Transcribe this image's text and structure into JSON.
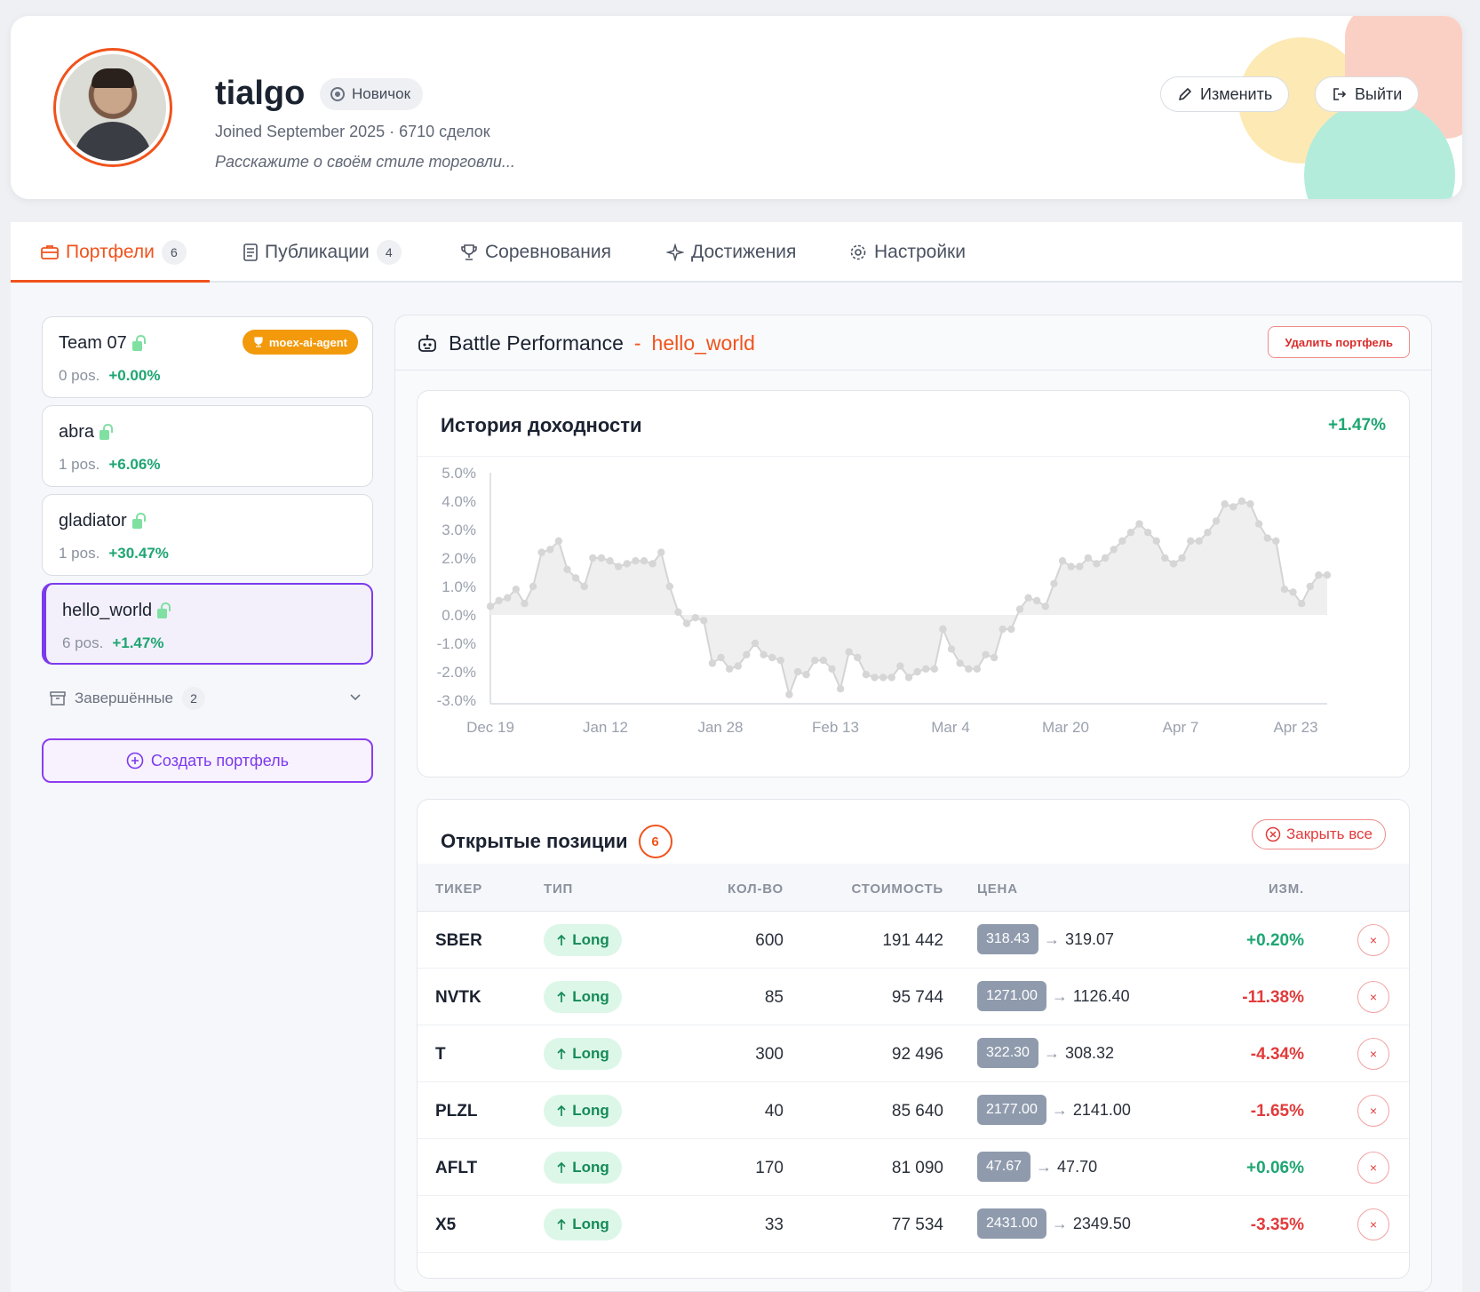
{
  "profile": {
    "username": "tialgo",
    "rank": "Новичок",
    "joined": "Joined September 2025 · 6710 сделок",
    "bio": "Расскажите о своём стиле торговли...",
    "edit_label": "Изменить",
    "logout_label": "Выйти"
  },
  "tabs": [
    {
      "label": "Портфели",
      "count": "6"
    },
    {
      "label": "Публикации",
      "count": "4"
    },
    {
      "label": "Соревнования"
    },
    {
      "label": "Достижения"
    },
    {
      "label": "Настройки"
    }
  ],
  "sidebar": {
    "portfolios": [
      {
        "name": "Team 07",
        "positions": "0 pos.",
        "return": "+0.00%",
        "badge": "moex-ai-agent"
      },
      {
        "name": "abra",
        "positions": "1 pos.",
        "return": "+6.06%"
      },
      {
        "name": "gladiator",
        "positions": "1 pos.",
        "return": "+30.47%"
      },
      {
        "name": "hello_world",
        "positions": "6 pos.",
        "return": "+1.47%"
      }
    ],
    "completed_label": "Завершённые",
    "completed_count": "2",
    "create_label": "Создать портфель"
  },
  "panel": {
    "title": "Battle Performance",
    "separator": "-",
    "portfolio_name": "hello_world",
    "delete_label": "Удалить портфель"
  },
  "chart": {
    "title": "История доходности",
    "total_return": "+1.47%"
  },
  "chart_data": {
    "type": "area",
    "title": "История доходности",
    "xlabel": "",
    "ylabel": "",
    "x_ticks": [
      "Dec 19",
      "Jan 12",
      "Jan 28",
      "Feb 13",
      "Mar 4",
      "Mar 20",
      "Apr 7",
      "Apr 23"
    ],
    "y_ticks": [
      "5.0%",
      "4.0%",
      "3.0%",
      "2.0%",
      "1.0%",
      "0.0%",
      "-1.0%",
      "-2.0%",
      "-3.0%"
    ],
    "ylim": [
      -3.0,
      5.0
    ],
    "grid": false,
    "series": [
      {
        "values": [
          0.3,
          0.5,
          0.6,
          0.9,
          0.4,
          1.0,
          2.2,
          2.3,
          2.6,
          1.6,
          1.3,
          1.0,
          2.0,
          2.0,
          1.9,
          1.7,
          1.8,
          1.9,
          1.9,
          1.8,
          2.2,
          1.0,
          0.1,
          -0.3,
          -0.1,
          -0.2,
          -1.7,
          -1.5,
          -1.9,
          -1.8,
          -1.4,
          -1.0,
          -1.4,
          -1.5,
          -1.6,
          -2.8,
          -2.0,
          -2.1,
          -1.6,
          -1.6,
          -1.9,
          -2.6,
          -1.3,
          -1.5,
          -2.1,
          -2.2,
          -2.2,
          -2.2,
          -1.8,
          -2.2,
          -2.0,
          -1.9,
          -1.9,
          -0.5,
          -1.2,
          -1.7,
          -1.9,
          -1.9,
          -1.4,
          -1.5,
          -0.5,
          -0.5,
          0.2,
          0.6,
          0.5,
          0.3,
          1.1,
          1.9,
          1.7,
          1.7,
          2.0,
          1.8,
          2.0,
          2.3,
          2.6,
          2.9,
          3.2,
          2.9,
          2.6,
          2.0,
          1.8,
          2.0,
          2.6,
          2.6,
          2.9,
          3.3,
          3.9,
          3.8,
          4.0,
          3.9,
          3.2,
          2.7,
          2.6,
          0.9,
          0.8,
          0.4,
          1.0,
          1.4,
          1.4
        ]
      }
    ]
  },
  "positions": {
    "title": "Открытые позиции",
    "count": "6",
    "close_all_label": "Закрыть все",
    "headers": {
      "ticker": "ТИКЕР",
      "type": "ТИП",
      "qty": "КОЛ-ВО",
      "value": "СТОИМОСТЬ",
      "price": "ЦЕНА",
      "change": "ИЗМ."
    },
    "rows": [
      {
        "ticker": "SBER",
        "type": "Long",
        "qty": "600",
        "value": "191 442",
        "entry": "318.43",
        "current": "319.07",
        "change": "+0.20%",
        "dir": "pos"
      },
      {
        "ticker": "NVTK",
        "type": "Long",
        "qty": "85",
        "value": "95 744",
        "entry": "1271.00",
        "current": "1126.40",
        "change": "-11.38%",
        "dir": "neg"
      },
      {
        "ticker": "T",
        "type": "Long",
        "qty": "300",
        "value": "92 496",
        "entry": "322.30",
        "current": "308.32",
        "change": "-4.34%",
        "dir": "neg"
      },
      {
        "ticker": "PLZL",
        "type": "Long",
        "qty": "40",
        "value": "85 640",
        "entry": "2177.00",
        "current": "2141.00",
        "change": "-1.65%",
        "dir": "neg"
      },
      {
        "ticker": "AFLT",
        "type": "Long",
        "qty": "170",
        "value": "81 090",
        "entry": "47.67",
        "current": "47.70",
        "change": "+0.06%",
        "dir": "pos"
      },
      {
        "ticker": "X5",
        "type": "Long",
        "qty": "33",
        "value": "77 534",
        "entry": "2431.00",
        "current": "2349.50",
        "change": "-3.35%",
        "dir": "neg"
      }
    ]
  },
  "colors": {
    "accent": "#f0531c",
    "purple": "#7c3aed",
    "positive": "#1ea672",
    "negative": "#e23b3b"
  }
}
